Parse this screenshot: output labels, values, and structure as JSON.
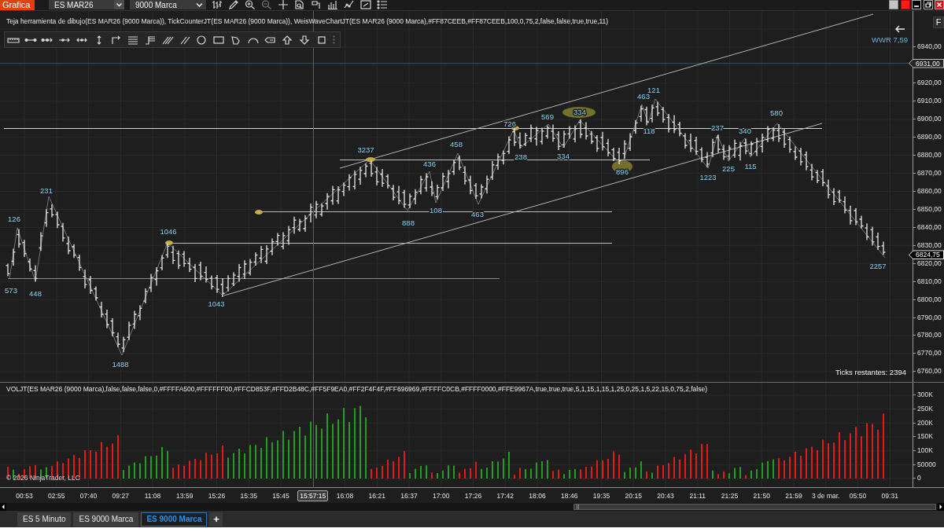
{
  "title_bar": {
    "menu_button": "Grafica",
    "instrument": "ES MAR26",
    "period": "9000 Marca"
  },
  "price_panel": {
    "indicator_label": "Teja herramienta de dibujo(ES MAR26 (9000 Marca)), TickCounterJT(ES MAR26 (9000 Marca)), WeisWaveChartJT(ES MAR26 (9000 Marca),#FF87CEEB,#FF87CEEB,100,0,75,2,false,false,true,true,11)",
    "wave_ratio": "WWR 7,59",
    "ticks_remaining": "Ticks restantes: 2394",
    "wave_labels": [
      "573",
      "126",
      "448",
      "231",
      "1488",
      "1046",
      "1043",
      "3237",
      "888",
      "436",
      "108",
      "458",
      "463",
      "726",
      "238",
      "569",
      "334",
      "334",
      "896",
      "463",
      "118",
      "121",
      "1223",
      "237",
      "225",
      "340",
      "115",
      "580",
      "2257"
    ],
    "axis_button": "F",
    "axis_labels": [
      {
        "label": "6940,00",
        "kind": "tick"
      },
      {
        "label": "6931,00",
        "kind": "crosshair"
      },
      {
        "label": "6920,00",
        "kind": "tick"
      },
      {
        "label": "6910,00",
        "kind": "tick"
      },
      {
        "label": "6900,00",
        "kind": "tick"
      },
      {
        "label": "6890,00",
        "kind": "tick"
      },
      {
        "label": "6880,00",
        "kind": "tick"
      },
      {
        "label": "6870,00",
        "kind": "tick"
      },
      {
        "label": "6860,00",
        "kind": "tick"
      },
      {
        "label": "6850,00",
        "kind": "tick"
      },
      {
        "label": "6840,00",
        "kind": "tick"
      },
      {
        "label": "6830,00",
        "kind": "tick"
      },
      {
        "label": "6820,00",
        "kind": "tick"
      },
      {
        "label": "6810,00",
        "kind": "tick"
      },
      {
        "label": "6800,00",
        "kind": "tick"
      },
      {
        "label": "6790,00",
        "kind": "tick"
      },
      {
        "label": "6780,00",
        "kind": "tick"
      },
      {
        "label": "6770,00",
        "kind": "tick"
      },
      {
        "label": "6760,00",
        "kind": "tick"
      }
    ],
    "last_price": "6824,75"
  },
  "volume_panel": {
    "indicator_label": "VOLJT(ES MAR26 (9000 Marca),false,false,false,0,#FFFFA500,#FFFFFF00,#FFCD853F,#FFD2B48C,#FF5F9EA0,#FF2F4F4F,#FF696969,#FFFFC0CB,#FFFF0000,#FFE9967A,true,true,true,5,1,15,1,15,1,25,0,25,1,5,22,15,0,75,2,false)",
    "axis_labels": [
      "300K",
      "250K",
      "200K",
      "150K",
      "100K",
      "50000",
      "0"
    ],
    "copyright": "© 2026 NinjaTrader, LLC"
  },
  "time_axis": {
    "labels": [
      {
        "label": "00:53",
        "kind": "tick"
      },
      {
        "label": "02:55",
        "kind": "tick"
      },
      {
        "label": "07:40",
        "kind": "tick"
      },
      {
        "label": "09:27",
        "kind": "tick"
      },
      {
        "label": "11:08",
        "kind": "tick"
      },
      {
        "label": "13:59",
        "kind": "tick"
      },
      {
        "label": "15:26",
        "kind": "tick"
      },
      {
        "label": "15:35",
        "kind": "tick"
      },
      {
        "label": "15:45",
        "kind": "tick"
      },
      {
        "label": "15:57:15",
        "kind": "crosshair"
      },
      {
        "label": "16:08",
        "kind": "tick"
      },
      {
        "label": "16:21",
        "kind": "tick"
      },
      {
        "label": "16:37",
        "kind": "tick"
      },
      {
        "label": "17:00",
        "kind": "tick"
      },
      {
        "label": "17:26",
        "kind": "tick"
      },
      {
        "label": "17:42",
        "kind": "tick"
      },
      {
        "label": "18:06",
        "kind": "tick"
      },
      {
        "label": "18:46",
        "kind": "tick"
      },
      {
        "label": "19:35",
        "kind": "tick"
      },
      {
        "label": "20:15",
        "kind": "tick"
      },
      {
        "label": "20:43",
        "kind": "tick"
      },
      {
        "label": "21:11",
        "kind": "tick"
      },
      {
        "label": "21:25",
        "kind": "tick"
      },
      {
        "label": "21:50",
        "kind": "tick"
      },
      {
        "label": "21:59",
        "kind": "tick"
      },
      {
        "label": "3 de mar.",
        "kind": "tick"
      },
      {
        "label": "05:50",
        "kind": "tick"
      },
      {
        "label": "09:31",
        "kind": "tick"
      }
    ]
  },
  "tabs": [
    {
      "label": "ES 5 Minuto",
      "selected": false
    },
    {
      "label": "ES 9000 Marca",
      "selected": false
    },
    {
      "label": "ES 9000 Marca",
      "selected": true
    }
  ],
  "add_tab_button": "+"
}
